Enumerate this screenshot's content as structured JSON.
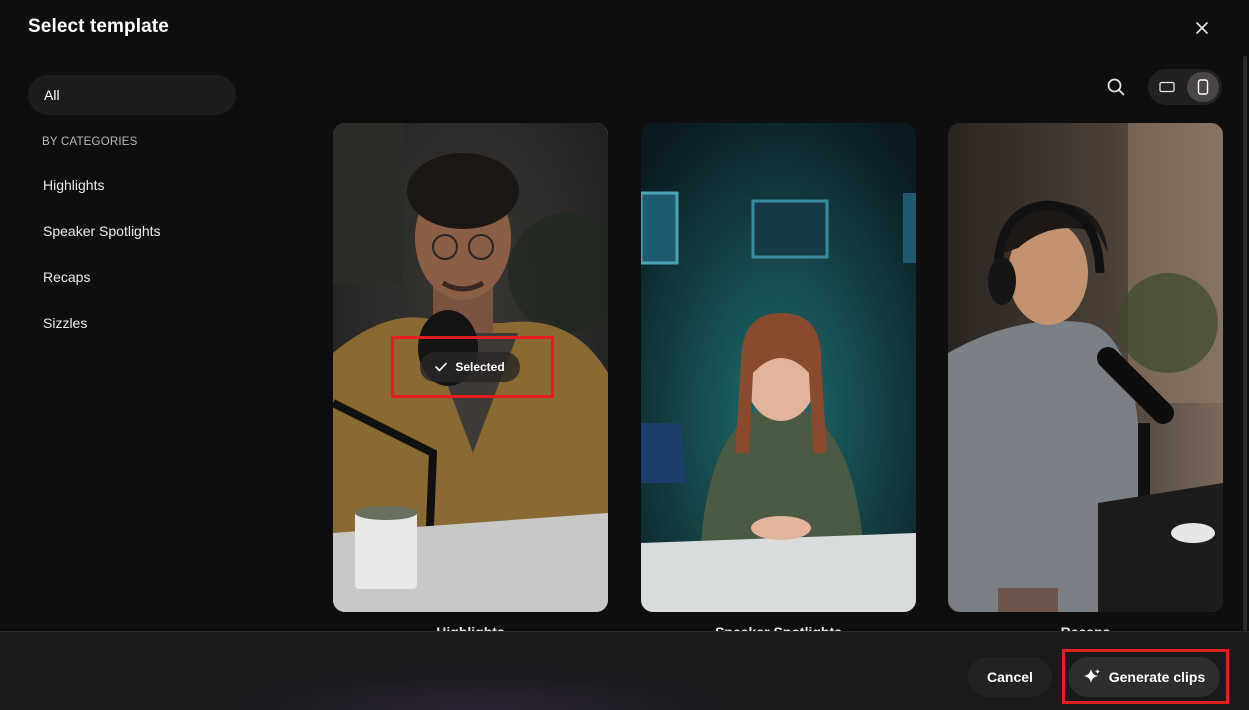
{
  "dialog": {
    "title": "Select template"
  },
  "sidebar": {
    "all_label": "All",
    "heading": "BY CATEGORIES",
    "items": [
      {
        "label": "Highlights"
      },
      {
        "label": "Speaker Spotlights"
      },
      {
        "label": "Recaps"
      },
      {
        "label": "Sizzles"
      }
    ]
  },
  "toolbar": {
    "search_icon": "search-icon",
    "view_options": [
      {
        "icon": "landscape-icon",
        "active": false
      },
      {
        "icon": "portrait-icon",
        "active": true
      }
    ]
  },
  "templates": [
    {
      "label": "Highlights",
      "selected": true,
      "selected_text": "Selected"
    },
    {
      "label": "Speaker Spotlights",
      "selected": false
    },
    {
      "label": "Recaps",
      "selected": false
    }
  ],
  "footer": {
    "cancel_label": "Cancel",
    "generate_label": "Generate clips",
    "generate_icon": "sparkle-icon"
  },
  "colors": {
    "background": "#0e0e0e",
    "highlight_annotation": "#e41e1e"
  }
}
